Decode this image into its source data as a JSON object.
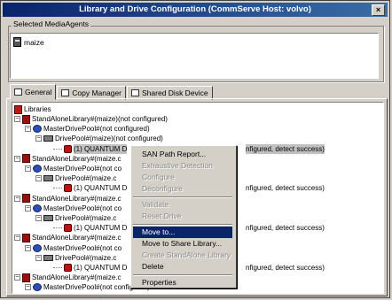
{
  "window": {
    "title": "Library and Drive Configuration (CommServe Host: volvo)",
    "close_label": "×"
  },
  "media_agents": {
    "label": "Selected MediaAgents",
    "items": [
      "maize"
    ]
  },
  "tabs": [
    {
      "label": "General",
      "icon": "general-icon",
      "active": true
    },
    {
      "label": "Copy Manager",
      "icon": "copy-manager-icon",
      "active": false
    },
    {
      "label": "Shared Disk Device",
      "icon": "disk-device-icon",
      "active": false
    }
  ],
  "tree": {
    "root": "Libraries",
    "rows": [
      {
        "text": "StandAloneLibrary#(maize)(not configured)",
        "kind": "library"
      },
      {
        "text": "MasterDrivePool#(not configured)",
        "kind": "master-pool"
      },
      {
        "text": "DrivePool#(maize)(not configured)",
        "kind": "drive-pool"
      },
      {
        "text": "(1) QUANTUM D",
        "suffix": "nfigured, detect success)",
        "kind": "drive"
      },
      {
        "text": "StandAloneLibrary#(maize.c",
        "kind": "library"
      },
      {
        "text": "MasterDrivePool#(not co",
        "kind": "master-pool"
      },
      {
        "text": "DrivePool#(maize.c",
        "kind": "drive-pool"
      },
      {
        "text": "(1) QUANTUM D",
        "suffix": "nfigured, detect success)",
        "kind": "drive"
      },
      {
        "text": "StandAloneLibrary#(maize.c",
        "kind": "library"
      },
      {
        "text": "MasterDrivePool#(not co",
        "kind": "master-pool"
      },
      {
        "text": "DrivePool#(maize.c",
        "kind": "drive-pool"
      },
      {
        "text": "(1) QUANTUM D",
        "suffix": "nfigured, detect success)",
        "kind": "drive"
      },
      {
        "text": "StandAloneLibrary#(maize.c",
        "kind": "library"
      },
      {
        "text": "MasterDrivePool#(not co",
        "kind": "master-pool"
      },
      {
        "text": "DrivePool#(maize.c",
        "kind": "drive-pool"
      },
      {
        "text": "(1) QUANTUM D",
        "suffix": "nfigured, detect success)",
        "kind": "drive"
      },
      {
        "text": "StandAloneLibrary#(maize.c",
        "kind": "library"
      },
      {
        "text": "MasterDrivePool#(not configured)",
        "kind": "master-pool"
      }
    ]
  },
  "context_menu": {
    "items": [
      {
        "label": "SAN Path Report...",
        "enabled": true,
        "selected": false
      },
      {
        "label": "Exhaustive Detection",
        "enabled": false,
        "selected": false
      },
      {
        "label": "Configure",
        "enabled": false,
        "selected": false
      },
      {
        "label": "Deconfigure",
        "enabled": false,
        "selected": false
      },
      {
        "separator": true
      },
      {
        "label": "Validate",
        "enabled": false,
        "selected": false
      },
      {
        "label": "Reset Drive",
        "enabled": false,
        "selected": false
      },
      {
        "separator": true
      },
      {
        "label": "Move to...",
        "enabled": true,
        "selected": true
      },
      {
        "label": "Move to Share Library...",
        "enabled": true,
        "selected": false
      },
      {
        "label": "Create StandAlone Library",
        "enabled": false,
        "selected": false
      },
      {
        "label": "Delete",
        "enabled": true,
        "selected": false
      },
      {
        "separator": true
      },
      {
        "label": "Properties",
        "enabled": true,
        "selected": false
      }
    ]
  }
}
